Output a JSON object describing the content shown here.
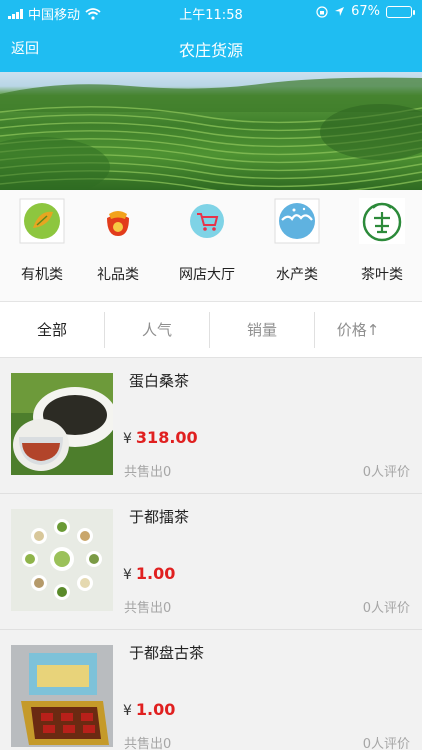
{
  "status_bar": {
    "carrier": "中国移动",
    "time": "上午11:58",
    "battery": "67%",
    "battery_level": 0.67
  },
  "nav": {
    "back_label": "返回",
    "title": "农庄货源"
  },
  "categories": [
    {
      "label": "有机类",
      "icon": "organic-icon"
    },
    {
      "label": "礼品类",
      "icon": "gift-bag-icon"
    },
    {
      "label": "网店大厅",
      "icon": "shopping-cart-icon"
    },
    {
      "label": "水产类",
      "icon": "water-splash-icon"
    },
    {
      "label": "茶叶类",
      "icon": "tea-seal-icon"
    }
  ],
  "sort_tabs": {
    "all": "全部",
    "popularity": "人气",
    "sales": "销量",
    "price": "价格↑"
  },
  "currency": "¥",
  "products": [
    {
      "name": "蛋白桑茶",
      "price": "318.00",
      "sold": "共售出0",
      "reviews": "0人评价"
    },
    {
      "name": "于都擂茶",
      "price": "1.00",
      "sold": "共售出0",
      "reviews": "0人评价"
    },
    {
      "name": "于都盘古茶",
      "price": "1.00",
      "sold": "共售出0",
      "reviews": "0人评价"
    }
  ]
}
